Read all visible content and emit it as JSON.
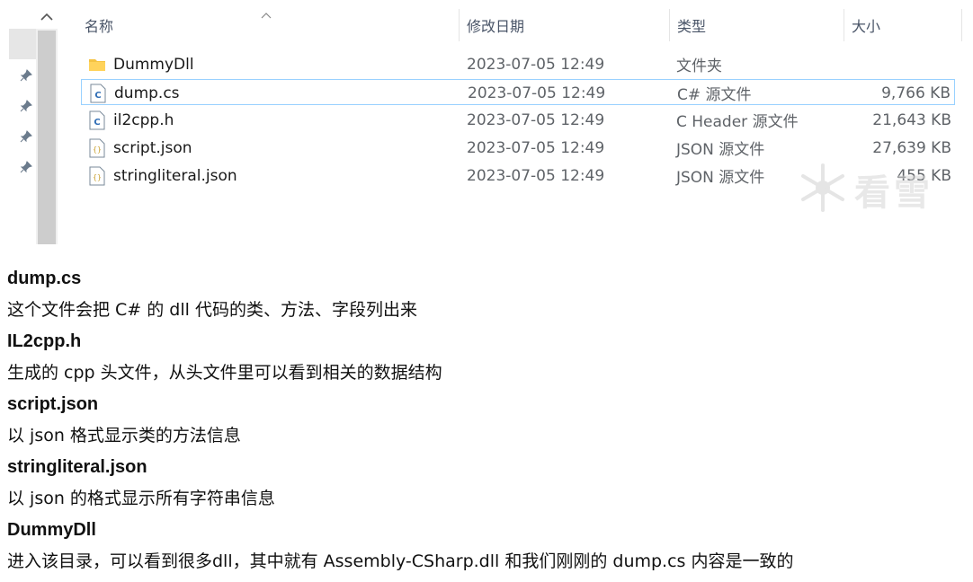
{
  "explorer": {
    "columns": {
      "name": "名称",
      "date": "修改日期",
      "type": "类型",
      "size": "大小"
    },
    "files": [
      {
        "name": "DummyDll",
        "date": "2023-07-05 12:49",
        "type": "文件夹",
        "size": "",
        "icon": "folder-icon"
      },
      {
        "name": "dump.cs",
        "date": "2023-07-05 12:49",
        "type": "C# 源文件",
        "size": "9,766 KB",
        "icon": "csharp-file-icon",
        "selected": true
      },
      {
        "name": "il2cpp.h",
        "date": "2023-07-05 12:49",
        "type": "C Header 源文件",
        "size": "21,643 KB",
        "icon": "c-header-file-icon"
      },
      {
        "name": "script.json",
        "date": "2023-07-05 12:49",
        "type": "JSON 源文件",
        "size": "27,639 KB",
        "icon": "json-file-icon"
      },
      {
        "name": "stringliteral.json",
        "date": "2023-07-05 12:49",
        "type": "JSON 源文件",
        "size": "455 KB",
        "icon": "json-file-icon"
      }
    ],
    "watermark": "看雪",
    "colors": {
      "selection_border": "#99d1ff",
      "folder": "#f5c342",
      "text_secondary": "#5f6368"
    }
  },
  "notes": [
    {
      "title": "dump.cs",
      "body": "这个文件会把 C# 的 dll 代码的类、方法、字段列出来"
    },
    {
      "title": "IL2cpp.h",
      "body": "生成的 cpp 头文件，从头文件里可以看到相关的数据结构"
    },
    {
      "title": "script.json",
      "body": "以 json 格式显示类的方法信息"
    },
    {
      "title": "stringliteral.json",
      "body": "以 json 的格式显示所有字符串信息"
    },
    {
      "title": "DummyDll",
      "body": "进入该目录，可以看到很多dll，其中就有 Assembly-CSharp.dll 和我们刚刚的 dump.cs 内容是一致的"
    }
  ]
}
